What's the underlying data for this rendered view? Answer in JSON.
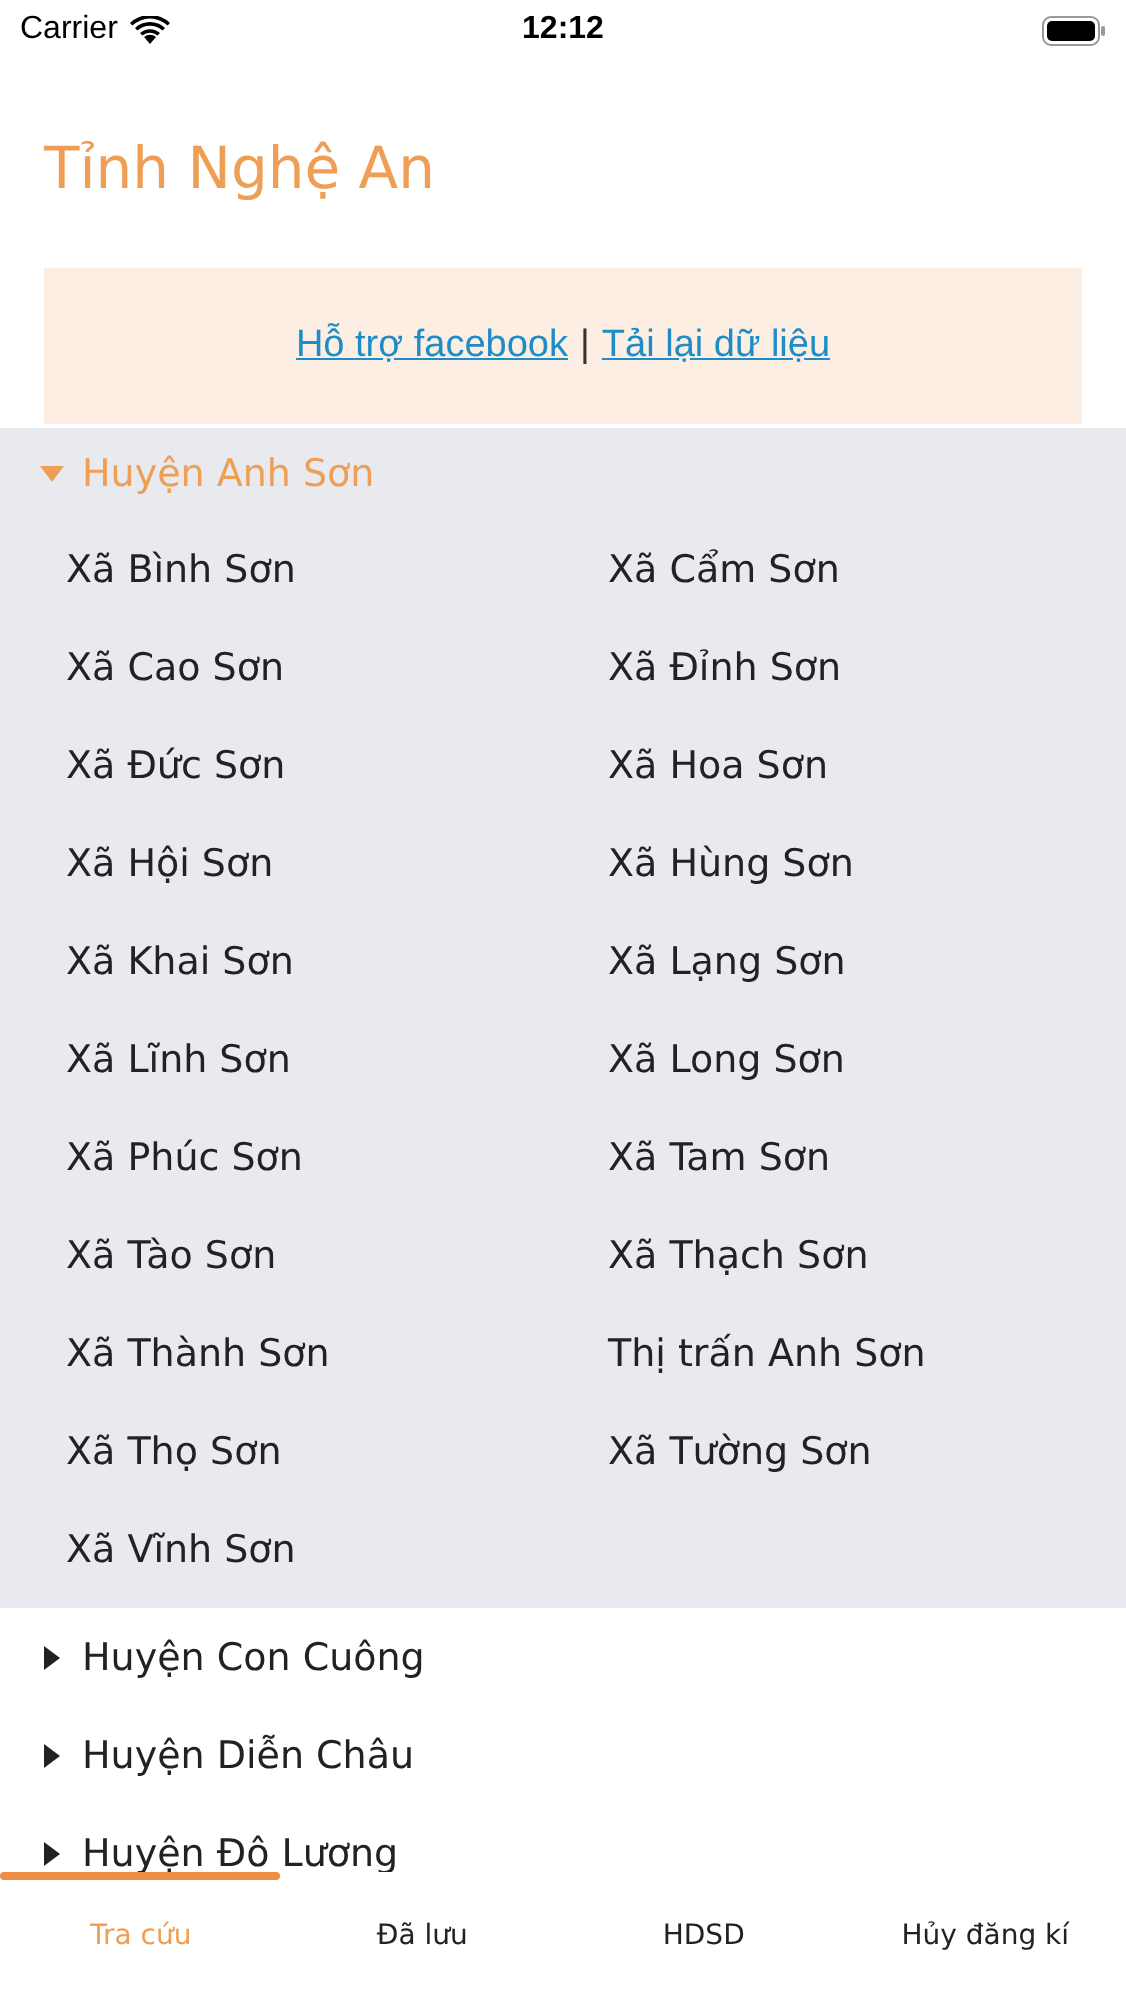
{
  "status_bar": {
    "carrier": "Carrier",
    "time": "12:12"
  },
  "title": "Tỉnh Nghệ An",
  "links": [
    {
      "label": "Hỗ trợ facebook"
    },
    {
      "separator": "|"
    },
    {
      "label": "Tải lại dữ liệu"
    }
  ],
  "districts": [
    {
      "name": "Huyện Anh Sơn",
      "expanded": true,
      "communes": [
        "Xã Bình Sơn",
        "Xã Cẩm Sơn",
        "Xã Cao Sơn",
        "Xã Đỉnh Sơn",
        "Xã Đức Sơn",
        "Xã Hoa Sơn",
        "Xã Hội Sơn",
        "Xã Hùng Sơn",
        "Xã Khai Sơn",
        "Xã Lạng Sơn",
        "Xã Lĩnh Sơn",
        "Xã Long Sơn",
        "Xã Phúc Sơn",
        "Xã Tam Sơn",
        "Xã Tào Sơn",
        "Xã Thạch Sơn",
        "Xã Thành Sơn",
        "Thị trấn Anh Sơn",
        "Xã Thọ Sơn",
        "Xã Tường Sơn",
        "Xã Vĩnh Sơn"
      ]
    },
    {
      "name": "Huyện Con Cuông",
      "expanded": false
    },
    {
      "name": "Huyện Diễn Châu",
      "expanded": false
    },
    {
      "name": "Huyện Đô Lương",
      "expanded": false
    }
  ],
  "tabs": [
    {
      "label": "Tra cứu",
      "selected": true
    },
    {
      "label": "Đã lưu",
      "selected": false
    },
    {
      "label": "HDSD",
      "selected": false
    },
    {
      "label": "Hủy đăng kí",
      "selected": false
    }
  ]
}
